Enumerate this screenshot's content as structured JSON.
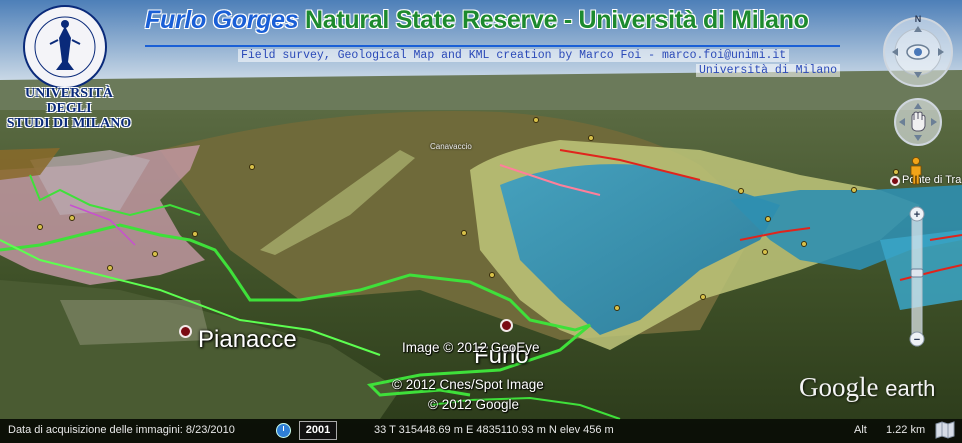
{
  "overlay": {
    "title_part1": "Furlo Gorges",
    "title_part2": "Natural State Reserve - Università di Milano",
    "credit_line1": "Field survey, Geological Map and KML creation by Marco Foi - marco.foi@unimi.it",
    "credit_line2": "Università di Milano"
  },
  "university": {
    "seal_text": "UNIVERSITAS STUDIORUM MEDIOLANENSIS",
    "name_line1": "UNIVERSITÀ DEGLI",
    "name_line2": "STUDI DI MILANO"
  },
  "map": {
    "places": {
      "pianacce": "Pianacce",
      "furlo": "Furlo",
      "canavaccio": "Canavaccio",
      "ponte": "Ponte di Tra"
    },
    "copyright": {
      "line1": "Image © 2012 GeoEye",
      "line2": "© 2012 Cnes/Spot Image",
      "line3": "© 2012 Google"
    },
    "logo": {
      "word1": "Google",
      "word2": "earth"
    }
  },
  "statusbar": {
    "acquisition": "Data di acquisizione delle immagini: 8/23/2010",
    "year": "2001",
    "coordinates": "33 T 315448.69 m E 4835110.93 m N elev   456 m",
    "alt_label": "Alt",
    "alt_value": "1.22 km"
  },
  "navigation": {
    "north_label": "N",
    "zoom_in": "+",
    "zoom_out": "−",
    "icons": [
      "look-ring-icon",
      "move-ring-icon",
      "pegman-icon",
      "zoom-slider",
      "compass-icon",
      "clock-icon"
    ]
  },
  "colors": {
    "geology_blue": "#2f8fb0",
    "geology_olive": "#8a8a3c",
    "geology_pink": "#c79aa8",
    "trail_green": "#3fe03a",
    "fault_red": "#e0241c"
  }
}
